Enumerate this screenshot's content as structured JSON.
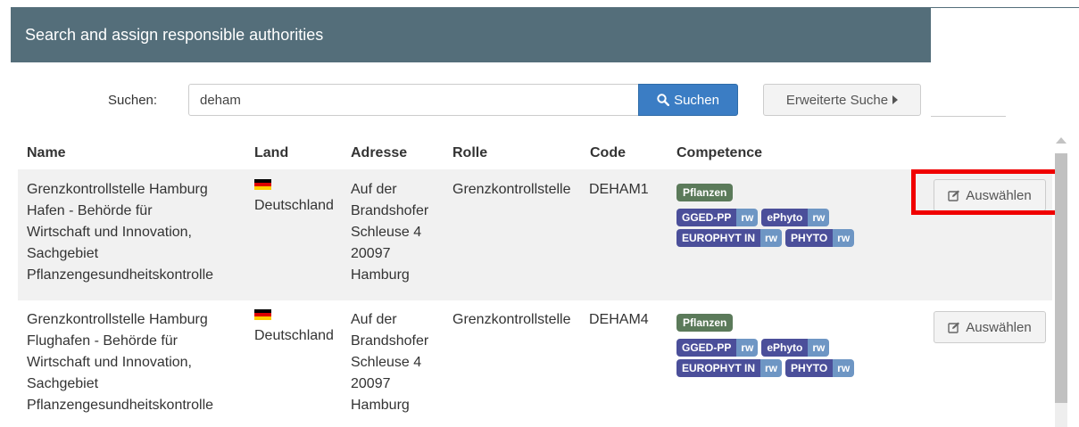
{
  "dialog": {
    "title": "Search and assign responsible authorities"
  },
  "search": {
    "label": "Suchen:",
    "value": "deham",
    "button_label": "Suchen",
    "button_icon": "search-icon",
    "advanced_label": "Erweiterte Suche",
    "advanced_icon": "caret-right-icon"
  },
  "table": {
    "headers": [
      "Name",
      "Land",
      "Adresse",
      "Rolle",
      "Code",
      "Competence"
    ],
    "rows": [
      {
        "name_lines": [
          "Grenzkontrollstelle Hamburg",
          "Hafen - Behörde für",
          "Wirtschaft und Innovation,",
          "Sachgebiet",
          "Pflanzengesundheitskontrolle"
        ],
        "country_flag": "germany-flag-icon",
        "country": "Deutschland",
        "address_lines": [
          "Auf der",
          "Brandshofer",
          "Schleuse 4",
          "20097",
          "Hamburg"
        ],
        "role": "Grenzkontrollstelle",
        "code": "DEHAM1",
        "category": "Pflanzen",
        "competences": [
          "GGED-PP",
          "ePhyto",
          "EUROPHYT IN",
          "PHYTO"
        ],
        "access": "rw",
        "action_label": "Auswählen"
      },
      {
        "name_lines": [
          "Grenzkontrollstelle Hamburg",
          "Flughafen - Behörde für",
          "Wirtschaft und Innovation,",
          "Sachgebiet",
          "Pflanzengesundheitskontrolle"
        ],
        "country_flag": "germany-flag-icon",
        "country": "Deutschland",
        "address_lines": [
          "Auf der",
          "Brandshofer",
          "Schleuse 4",
          "20097",
          "Hamburg"
        ],
        "role": "Grenzkontrollstelle",
        "code": "DEHAM4",
        "category": "Pflanzen",
        "competences": [
          "GGED-PP",
          "ePhyto",
          "EUROPHYT IN",
          "PHYTO"
        ],
        "access": "rw",
        "action_label": "Auswählen"
      }
    ]
  },
  "colors": {
    "header_bg": "#546e7a",
    "primary": "#3b7dc4",
    "competence": "#4b4f9a",
    "rw": "#6e96c4",
    "category": "#5b7a5a",
    "highlight": "#f00000"
  }
}
